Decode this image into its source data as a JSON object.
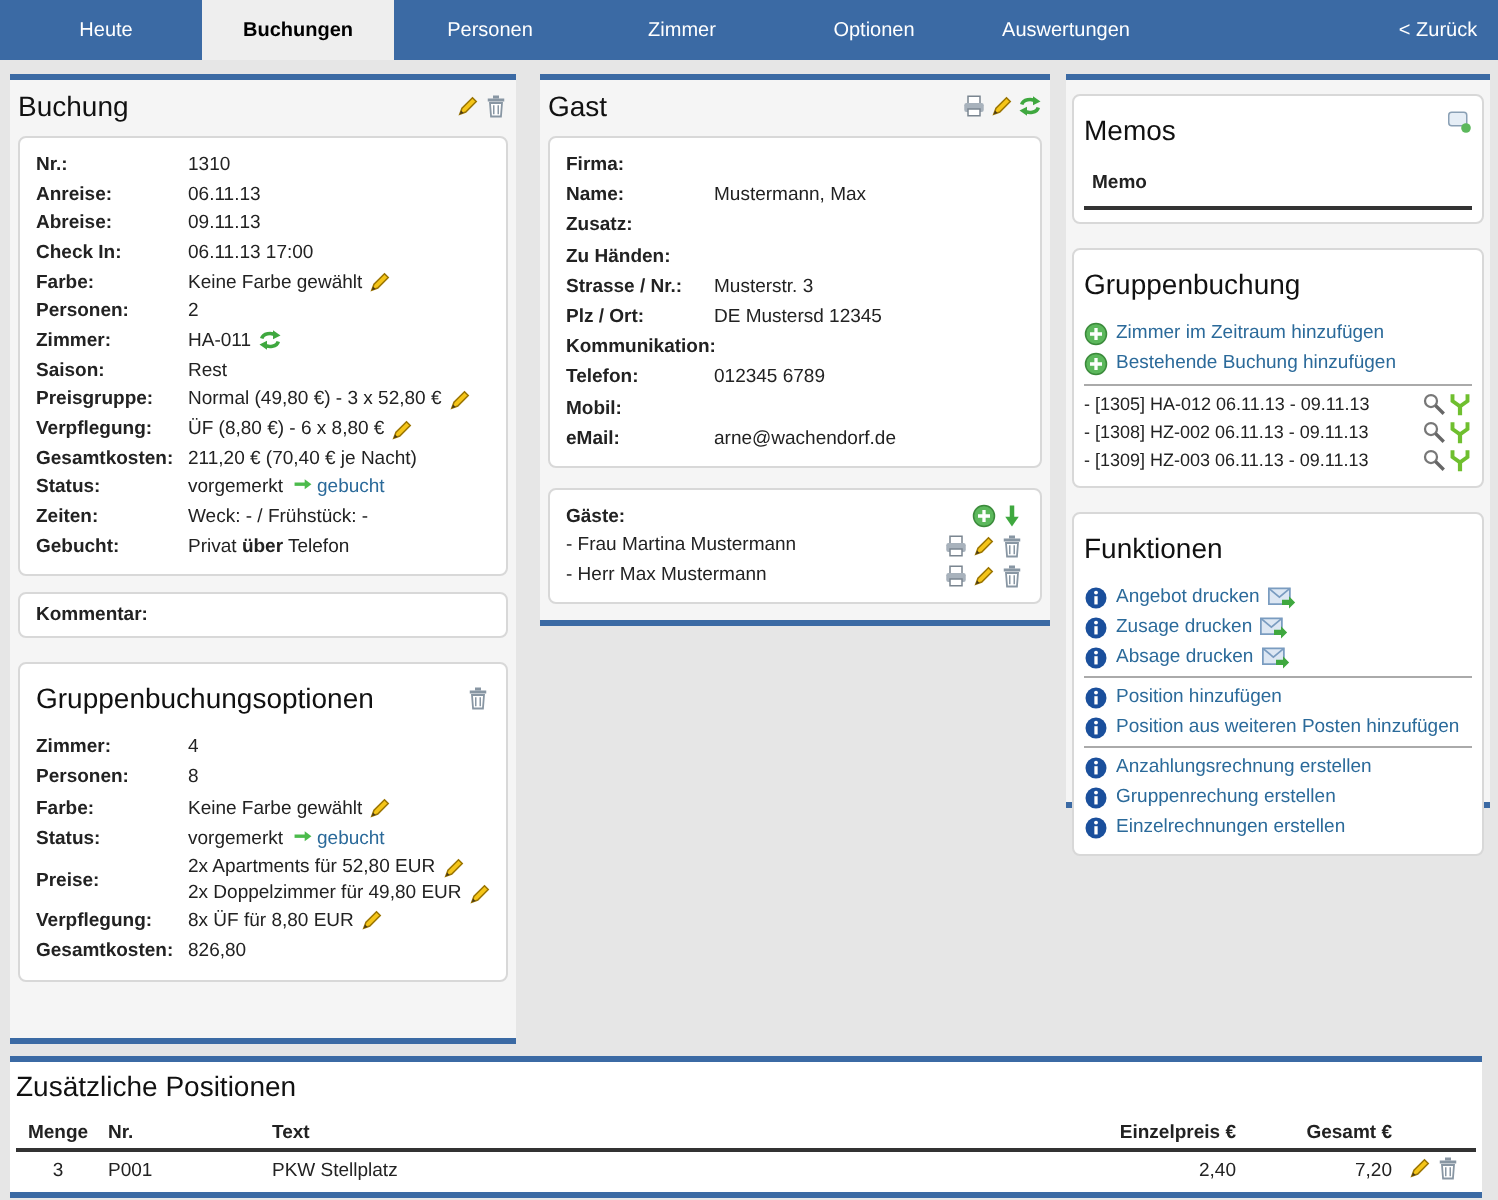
{
  "nav": [
    {
      "label": "Heute",
      "kind": "tab",
      "selected": false
    },
    {
      "label": "Buchungen",
      "kind": "tab",
      "selected": true
    },
    {
      "label": "Personen",
      "kind": "tab",
      "selected": false
    },
    {
      "label": "Zimmer",
      "kind": "tab",
      "selected": false
    },
    {
      "label": "Optionen",
      "kind": "tab",
      "selected": false
    },
    {
      "label": "Auswertungen",
      "kind": "tab",
      "selected": false
    },
    {
      "label": "< Zurück",
      "kind": "back",
      "selected": false
    }
  ],
  "booking": {
    "title": "Buchung",
    "rows": [
      {
        "label": "Nr.:",
        "value": "1310",
        "kind": "text"
      },
      {
        "label": "Anreise:",
        "value": "06.11.13",
        "kind": "text"
      },
      {
        "label": "Abreise:",
        "value": "09.11.13",
        "kind": "text"
      },
      {
        "label": "Check In:",
        "value": "06.11.13 17:00",
        "kind": "text"
      },
      {
        "label": "Farbe:",
        "value": "Keine Farbe gewählt",
        "kind": "edit"
      },
      {
        "label": "Personen:",
        "value": "2",
        "kind": "text"
      },
      {
        "label": "Zimmer:",
        "value": "HA-011",
        "kind": "swap"
      },
      {
        "label": "Saison:",
        "value": "Rest",
        "kind": "text"
      },
      {
        "label": "Preisgruppe:",
        "value": "Normal (49,80 €) - 3 x 52,80 €",
        "kind": "edit"
      },
      {
        "label": "Verpflegung:",
        "value": "ÜF (8,80 €) - 6 x 8,80 €",
        "kind": "edit"
      },
      {
        "label": "Gesamtkosten:",
        "value": "211,20 € (70,40 € je Nacht)",
        "kind": "text"
      },
      {
        "label": "Status:",
        "value": "vorgemerkt",
        "link": "gebucht",
        "kind": "status"
      },
      {
        "label": "Zeiten:",
        "value": "Weck: - / Frühstück: -",
        "kind": "text"
      },
      {
        "label": "Gebucht:",
        "value": "Privat **über** Telefon",
        "kind": "text"
      }
    ],
    "comment_label": "Kommentar:"
  },
  "group_options": {
    "title": "Gruppenbuchungsoptionen",
    "rows": [
      {
        "label": "Zimmer:",
        "value": "4",
        "kind": "text"
      },
      {
        "label": "Personen:",
        "value": "8",
        "kind": "text"
      },
      {
        "label": "Farbe:",
        "value": "Keine Farbe gewählt",
        "kind": "edit"
      },
      {
        "label": "Status:",
        "value": "vorgemerkt",
        "link": "gebucht",
        "kind": "status"
      },
      {
        "label": "Preise:",
        "values": [
          "2x Apartments für 52,80 EUR",
          "2x Doppelzimmer für 49,80 EUR"
        ],
        "kind": "edit_lines"
      },
      {
        "label": "Verpflegung:",
        "value": "8x ÜF für 8,80 EUR",
        "kind": "edit"
      },
      {
        "label": "Gesamtkosten:",
        "value": "826,80",
        "kind": "text"
      }
    ]
  },
  "guest": {
    "title": "Gast",
    "rows": [
      {
        "label": "Firma:"
      },
      {
        "label": "Name:",
        "value": "Mustermann, Max"
      },
      {
        "label": "Zusatz:"
      },
      {
        "label": "Zu Händen:"
      },
      {
        "label": "Strasse / Nr.:",
        "value": "Musterstr. 3"
      },
      {
        "label": "Plz / Ort:",
        "value": "DE Mustersd 12345"
      },
      {
        "label": "Kommunikation:"
      },
      {
        "label": "Telefon:",
        "value": "012345 6789"
      },
      {
        "label": "Mobil:"
      },
      {
        "label": "eMail:",
        "value": "arne@wachendorf.de"
      }
    ],
    "guests_label": "Gäste:",
    "guests": [
      "- Frau Martina Mustermann",
      "- Herr Max Mustermann"
    ]
  },
  "memos": {
    "title": "Memos",
    "column": "Memo"
  },
  "group_booking": {
    "title": "Gruppenbuchung",
    "actions": [
      "Zimmer im Zeitraum hinzufügen",
      "Bestehende Buchung hinzufügen"
    ],
    "bookings": [
      "- [1305] HA-012 06.11.13 - 09.11.13",
      "- [1308] HZ-002 06.11.13 - 09.11.13",
      "- [1309] HZ-003 06.11.13 - 09.11.13"
    ]
  },
  "functions": {
    "title": "Funktionen",
    "groups": [
      [
        {
          "label": "Angebot drucken",
          "kind": "mail"
        },
        {
          "label": "Zusage drucken",
          "kind": "mail"
        },
        {
          "label": "Absage drucken",
          "kind": "mail"
        }
      ],
      [
        {
          "label": "Position hinzufügen",
          "kind": "plain"
        },
        {
          "label": "Position aus weiteren Posten hinzufügen",
          "kind": "plain"
        }
      ],
      [
        {
          "label": "Anzahlungsrechnung erstellen",
          "kind": "plain"
        },
        {
          "label": "Gruppenrechung erstellen",
          "kind": "plain"
        },
        {
          "label": "Einzelrechnungen erstellen",
          "kind": "plain"
        }
      ]
    ]
  },
  "positions": {
    "title": "Zusätzliche Positionen",
    "columns": [
      "Menge",
      "Nr.",
      "Text",
      "Einzelpreis €",
      "Gesamt €"
    ],
    "rows": [
      {
        "cells": [
          "3",
          "P001",
          "PKW Stellplatz",
          "2,40",
          "7,20"
        ]
      }
    ]
  }
}
